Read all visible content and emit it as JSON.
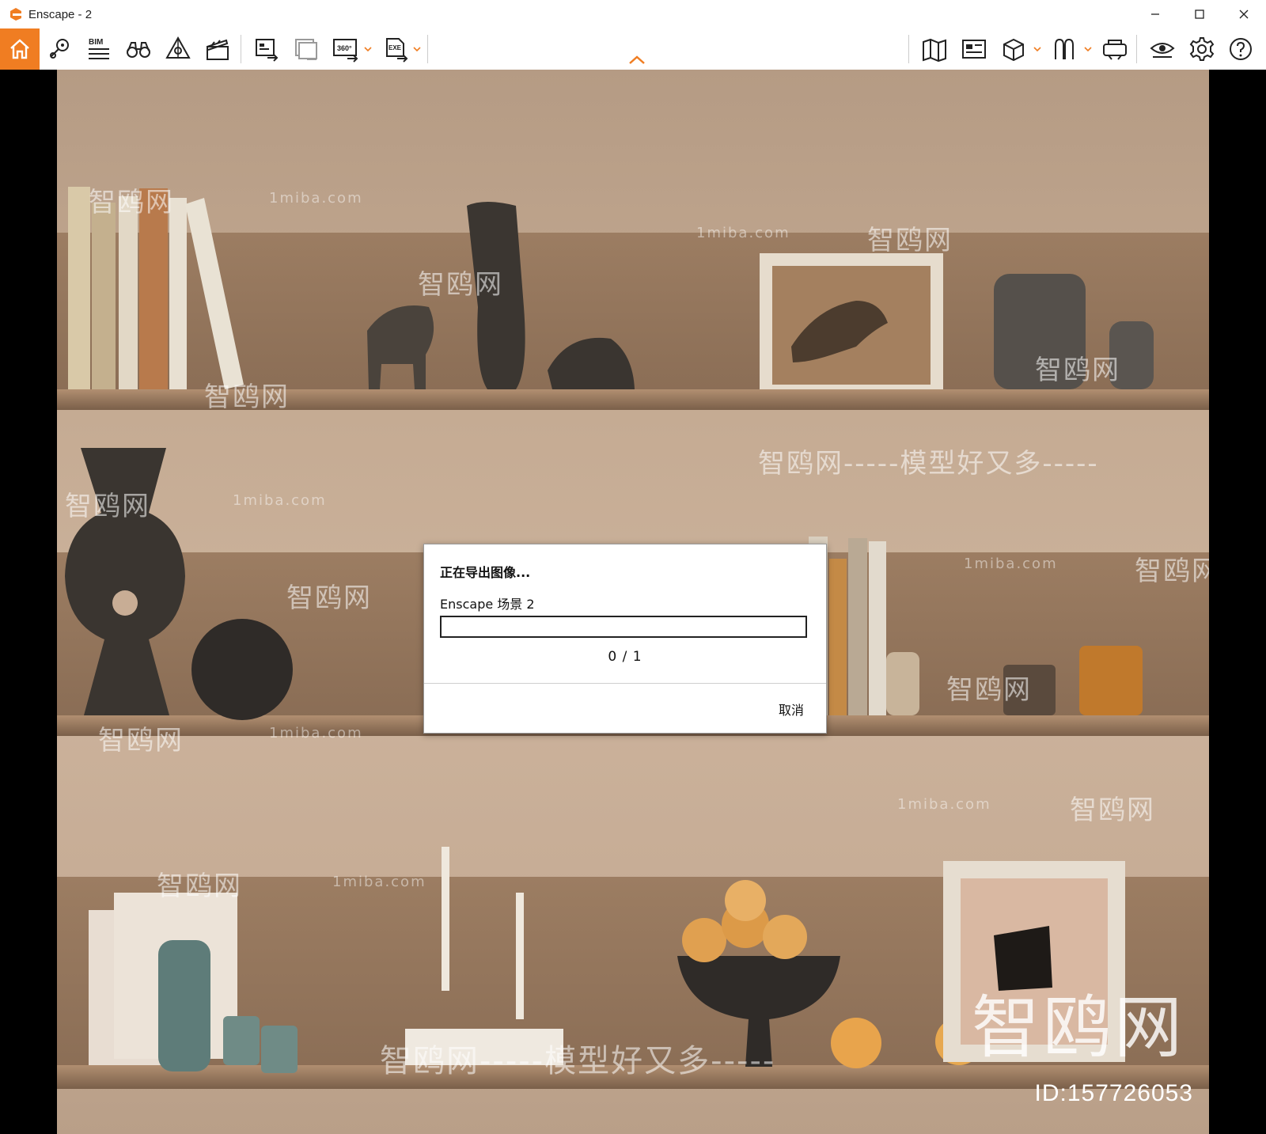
{
  "window": {
    "title": "Enscape - 2",
    "accent_color": "#f07d22",
    "controls": [
      "minimize-icon",
      "maximize-icon",
      "close-icon"
    ]
  },
  "toolbar": {
    "left_tools": [
      {
        "name": "home",
        "icon": "home-icon"
      },
      {
        "name": "location",
        "icon": "map-pin-icon"
      },
      {
        "name": "bim",
        "icon": "bim-icon",
        "label": "BIM"
      },
      {
        "name": "views",
        "icon": "binoculars-icon"
      },
      {
        "name": "assets",
        "icon": "asset-library-icon"
      },
      {
        "name": "video",
        "icon": "clapperboard-icon"
      },
      {
        "name": "screenshot",
        "icon": "render-export-icon"
      },
      {
        "name": "batch",
        "icon": "batch-render-icon"
      },
      {
        "name": "panorama",
        "icon": "panorama-360-icon",
        "label": "360°"
      },
      {
        "name": "exe",
        "icon": "exe-export-icon",
        "label": "EXE"
      }
    ],
    "right_tools": [
      {
        "name": "map",
        "icon": "map-icon"
      },
      {
        "name": "orthographic",
        "icon": "view-icon"
      },
      {
        "name": "cube",
        "icon": "cube-icon"
      },
      {
        "name": "people",
        "icon": "people-icon"
      },
      {
        "name": "vr",
        "icon": "vr-headset-icon"
      },
      {
        "name": "eye",
        "icon": "eye-icon"
      },
      {
        "name": "settings",
        "icon": "gear-icon"
      },
      {
        "name": "help",
        "icon": "help-icon"
      }
    ]
  },
  "dialog": {
    "title": "正在导出图像...",
    "scene_label": "Enscape 场景 2",
    "progress": 0,
    "count_text": "0 / 1",
    "cancel_label": "取消"
  },
  "watermarks": {
    "site_cn": "智鸥网",
    "site_en": "1miba.com",
    "slogan": "智鸥网-----模型好又多-----",
    "brand": "智鸥网",
    "id_text": "ID:157726053"
  }
}
